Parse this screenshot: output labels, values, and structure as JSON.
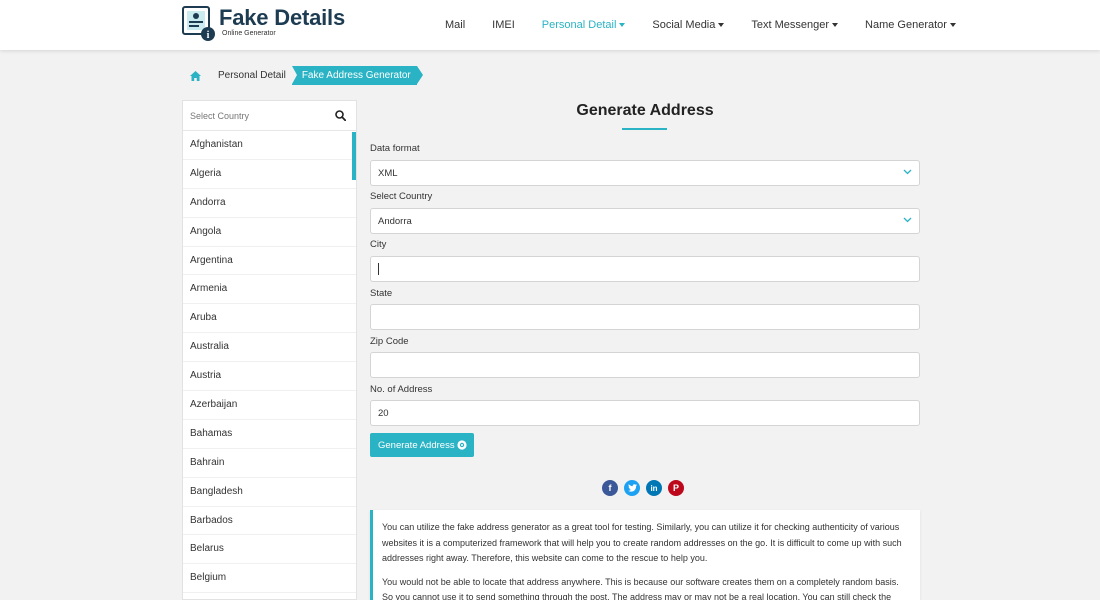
{
  "brand": {
    "title": "Fake Details",
    "subtitle": "Online Generator"
  },
  "nav": [
    {
      "label": "Mail",
      "caret": false,
      "active": false
    },
    {
      "label": "IMEI",
      "caret": false,
      "active": false
    },
    {
      "label": "Personal Detail",
      "caret": true,
      "active": true
    },
    {
      "label": "Social Media",
      "caret": true,
      "active": false
    },
    {
      "label": "Text Messenger",
      "caret": true,
      "active": false
    },
    {
      "label": "Name Generator",
      "caret": true,
      "active": false
    }
  ],
  "breadcrumb": {
    "home_icon": "home-icon",
    "parent": "Personal Detail",
    "current": "Fake Address Generator"
  },
  "sidebar": {
    "search_placeholder": "Select Country",
    "countries": [
      "Afghanistan",
      "Algeria",
      "Andorra",
      "Angola",
      "Argentina",
      "Armenia",
      "Aruba",
      "Australia",
      "Austria",
      "Azerbaijan",
      "Bahamas",
      "Bahrain",
      "Bangladesh",
      "Barbados",
      "Belarus",
      "Belgium"
    ]
  },
  "form": {
    "title": "Generate Address",
    "data_format_label": "Data format",
    "data_format_value": "XML",
    "country_label": "Select Country",
    "country_value": "Andorra",
    "city_label": "City",
    "city_value": "",
    "state_label": "State",
    "state_value": "",
    "zip_label": "Zip Code",
    "zip_value": "",
    "count_label": "No. of Address",
    "count_value": "20",
    "button_label": "Generate Address"
  },
  "social_icons": [
    "facebook-icon",
    "twitter-icon",
    "linkedin-icon",
    "pinterest-icon"
  ],
  "info": {
    "p1": "You can utilize the fake address generator as a great tool for testing. Similarly, you can utilize it for checking authenticity of various websites it is a computerized framework that will help you to create random addresses on the go. It is difficult to come up with such addresses right away. Therefore, this website can come to the rescue to help you.",
    "p2": "You would not be able to locate that address anywhere. This is because our software creates them on a completely random basis. So you cannot use it to send something through the post. The address may or may not be a real location. You can still check the"
  },
  "colors": {
    "accent": "#2ab3c4",
    "brand_dark": "#1d3c52"
  }
}
